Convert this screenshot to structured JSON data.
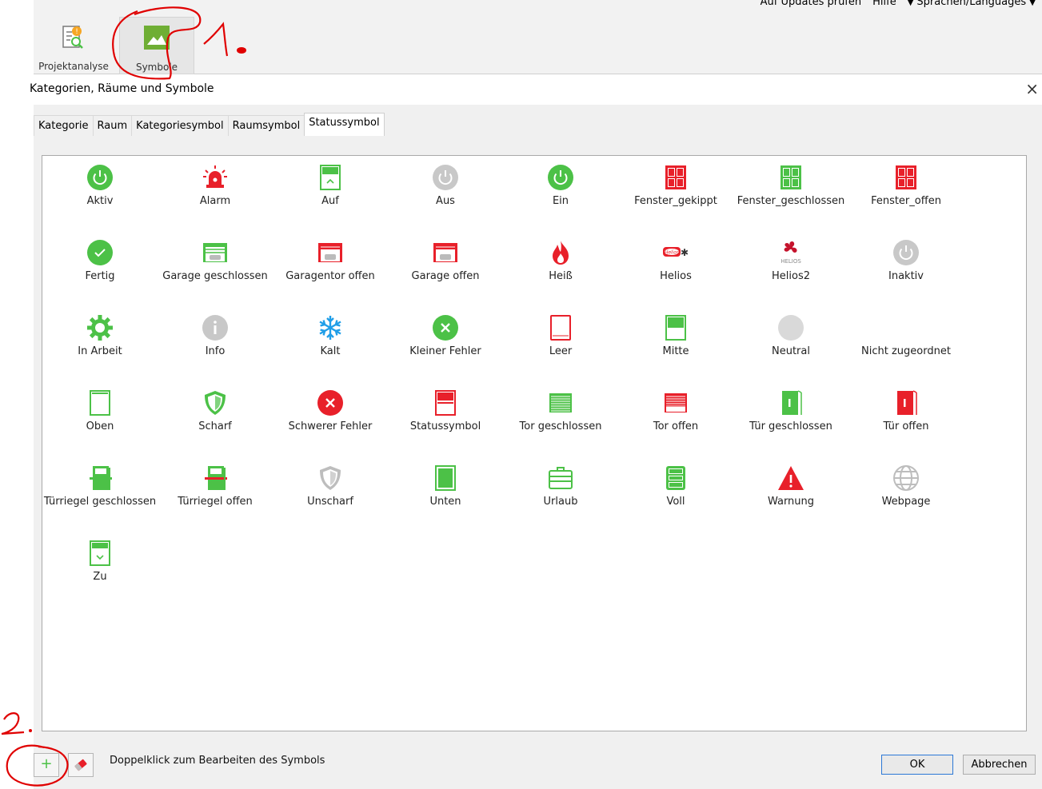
{
  "topmenu": {
    "updates": "Auf Updates prüfen",
    "help": "Hilfe",
    "languages": "Sprachen/Languages"
  },
  "ribbon": {
    "project_analysis": "Projektanalyse",
    "symbols": "Symbole"
  },
  "dialog": {
    "title": "Kategorien, Räume und Symbole",
    "close": "×",
    "tabs": [
      "Kategorie",
      "Raum",
      "Kategoriesymbol",
      "Raumsymbol",
      "Statussymbol"
    ],
    "active_tab": "Statussymbol",
    "hint": "Doppelklick zum Bearbeiten des Symbols",
    "ok": "OK",
    "cancel": "Abbrechen",
    "add": "+"
  },
  "symbols": [
    {
      "label": "Aktiv",
      "icon": "power-green"
    },
    {
      "label": "Alarm",
      "icon": "alarm-red"
    },
    {
      "label": "Auf",
      "icon": "blind-up-green"
    },
    {
      "label": "Aus",
      "icon": "power-grey"
    },
    {
      "label": "Ein",
      "icon": "power-green"
    },
    {
      "label": "Fenster_gekippt",
      "icon": "window-red"
    },
    {
      "label": "Fenster_geschlossen",
      "icon": "window-green"
    },
    {
      "label": "Fenster_offen",
      "icon": "window-red"
    },
    {
      "label": "Fertig",
      "icon": "check-green"
    },
    {
      "label": "Garage geschlossen",
      "icon": "garage-closed-green"
    },
    {
      "label": "Garagentor offen",
      "icon": "garage-open-red"
    },
    {
      "label": "Garage offen",
      "icon": "garage-open-red"
    },
    {
      "label": "Heiß",
      "icon": "flame-red"
    },
    {
      "label": "Helios",
      "icon": "helios-logo"
    },
    {
      "label": "Helios2",
      "icon": "helios-fan"
    },
    {
      "label": "Inaktiv",
      "icon": "power-grey"
    },
    {
      "label": "In Arbeit",
      "icon": "gear-green"
    },
    {
      "label": "Info",
      "icon": "info-grey"
    },
    {
      "label": "Kalt",
      "icon": "snowflake-blue"
    },
    {
      "label": "Kleiner Fehler",
      "icon": "x-green"
    },
    {
      "label": "Leer",
      "icon": "box-empty-red"
    },
    {
      "label": "Mitte",
      "icon": "blind-half-green"
    },
    {
      "label": "Neutral",
      "icon": "circle-grey"
    },
    {
      "label": "Nicht zugeordnet",
      "icon": "none"
    },
    {
      "label": "Oben",
      "icon": "box-empty-green"
    },
    {
      "label": "Scharf",
      "icon": "shield-green"
    },
    {
      "label": "Schwerer Fehler",
      "icon": "x-red"
    },
    {
      "label": "Statussymbol",
      "icon": "blind-red"
    },
    {
      "label": "Tor geschlossen",
      "icon": "gate-closed-green"
    },
    {
      "label": "Tor offen",
      "icon": "gate-open-red"
    },
    {
      "label": "Tür geschlossen",
      "icon": "door-green"
    },
    {
      "label": "Tür offen",
      "icon": "door-red"
    },
    {
      "label": "Türriegel geschlossen",
      "icon": "doorbolt-green"
    },
    {
      "label": "Türriegel offen",
      "icon": "doorbolt-red"
    },
    {
      "label": "Unscharf",
      "icon": "shield-grey"
    },
    {
      "label": "Unten",
      "icon": "blind-down-green"
    },
    {
      "label": "Urlaub",
      "icon": "suitcase-green"
    },
    {
      "label": "Voll",
      "icon": "blind-full-green"
    },
    {
      "label": "Warnung",
      "icon": "warning-red"
    },
    {
      "label": "Webpage",
      "icon": "globe-grey"
    },
    {
      "label": "Zu",
      "icon": "blind-down-box-green"
    }
  ],
  "annotations": {
    "mark1": "1.",
    "mark2": "2."
  },
  "colors": {
    "green": "#4cc147",
    "red": "#e8202a",
    "grey": "#c8c8c8",
    "blue": "#1f9ee8",
    "ink": "#e00000"
  }
}
